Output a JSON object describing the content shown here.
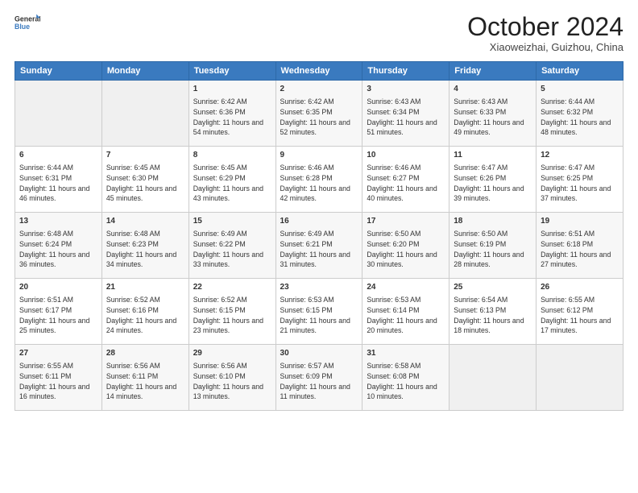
{
  "header": {
    "logo_line1": "General",
    "logo_line2": "Blue",
    "main_title": "October 2024",
    "subtitle": "Xiaoweizhai, Guizhou, China"
  },
  "weekdays": [
    "Sunday",
    "Monday",
    "Tuesday",
    "Wednesday",
    "Thursday",
    "Friday",
    "Saturday"
  ],
  "weeks": [
    [
      {
        "num": "",
        "info": ""
      },
      {
        "num": "",
        "info": ""
      },
      {
        "num": "1",
        "info": "Sunrise: 6:42 AM\nSunset: 6:36 PM\nDaylight: 11 hours and 54 minutes."
      },
      {
        "num": "2",
        "info": "Sunrise: 6:42 AM\nSunset: 6:35 PM\nDaylight: 11 hours and 52 minutes."
      },
      {
        "num": "3",
        "info": "Sunrise: 6:43 AM\nSunset: 6:34 PM\nDaylight: 11 hours and 51 minutes."
      },
      {
        "num": "4",
        "info": "Sunrise: 6:43 AM\nSunset: 6:33 PM\nDaylight: 11 hours and 49 minutes."
      },
      {
        "num": "5",
        "info": "Sunrise: 6:44 AM\nSunset: 6:32 PM\nDaylight: 11 hours and 48 minutes."
      }
    ],
    [
      {
        "num": "6",
        "info": "Sunrise: 6:44 AM\nSunset: 6:31 PM\nDaylight: 11 hours and 46 minutes."
      },
      {
        "num": "7",
        "info": "Sunrise: 6:45 AM\nSunset: 6:30 PM\nDaylight: 11 hours and 45 minutes."
      },
      {
        "num": "8",
        "info": "Sunrise: 6:45 AM\nSunset: 6:29 PM\nDaylight: 11 hours and 43 minutes."
      },
      {
        "num": "9",
        "info": "Sunrise: 6:46 AM\nSunset: 6:28 PM\nDaylight: 11 hours and 42 minutes."
      },
      {
        "num": "10",
        "info": "Sunrise: 6:46 AM\nSunset: 6:27 PM\nDaylight: 11 hours and 40 minutes."
      },
      {
        "num": "11",
        "info": "Sunrise: 6:47 AM\nSunset: 6:26 PM\nDaylight: 11 hours and 39 minutes."
      },
      {
        "num": "12",
        "info": "Sunrise: 6:47 AM\nSunset: 6:25 PM\nDaylight: 11 hours and 37 minutes."
      }
    ],
    [
      {
        "num": "13",
        "info": "Sunrise: 6:48 AM\nSunset: 6:24 PM\nDaylight: 11 hours and 36 minutes."
      },
      {
        "num": "14",
        "info": "Sunrise: 6:48 AM\nSunset: 6:23 PM\nDaylight: 11 hours and 34 minutes."
      },
      {
        "num": "15",
        "info": "Sunrise: 6:49 AM\nSunset: 6:22 PM\nDaylight: 11 hours and 33 minutes."
      },
      {
        "num": "16",
        "info": "Sunrise: 6:49 AM\nSunset: 6:21 PM\nDaylight: 11 hours and 31 minutes."
      },
      {
        "num": "17",
        "info": "Sunrise: 6:50 AM\nSunset: 6:20 PM\nDaylight: 11 hours and 30 minutes."
      },
      {
        "num": "18",
        "info": "Sunrise: 6:50 AM\nSunset: 6:19 PM\nDaylight: 11 hours and 28 minutes."
      },
      {
        "num": "19",
        "info": "Sunrise: 6:51 AM\nSunset: 6:18 PM\nDaylight: 11 hours and 27 minutes."
      }
    ],
    [
      {
        "num": "20",
        "info": "Sunrise: 6:51 AM\nSunset: 6:17 PM\nDaylight: 11 hours and 25 minutes."
      },
      {
        "num": "21",
        "info": "Sunrise: 6:52 AM\nSunset: 6:16 PM\nDaylight: 11 hours and 24 minutes."
      },
      {
        "num": "22",
        "info": "Sunrise: 6:52 AM\nSunset: 6:15 PM\nDaylight: 11 hours and 23 minutes."
      },
      {
        "num": "23",
        "info": "Sunrise: 6:53 AM\nSunset: 6:15 PM\nDaylight: 11 hours and 21 minutes."
      },
      {
        "num": "24",
        "info": "Sunrise: 6:53 AM\nSunset: 6:14 PM\nDaylight: 11 hours and 20 minutes."
      },
      {
        "num": "25",
        "info": "Sunrise: 6:54 AM\nSunset: 6:13 PM\nDaylight: 11 hours and 18 minutes."
      },
      {
        "num": "26",
        "info": "Sunrise: 6:55 AM\nSunset: 6:12 PM\nDaylight: 11 hours and 17 minutes."
      }
    ],
    [
      {
        "num": "27",
        "info": "Sunrise: 6:55 AM\nSunset: 6:11 PM\nDaylight: 11 hours and 16 minutes."
      },
      {
        "num": "28",
        "info": "Sunrise: 6:56 AM\nSunset: 6:11 PM\nDaylight: 11 hours and 14 minutes."
      },
      {
        "num": "29",
        "info": "Sunrise: 6:56 AM\nSunset: 6:10 PM\nDaylight: 11 hours and 13 minutes."
      },
      {
        "num": "30",
        "info": "Sunrise: 6:57 AM\nSunset: 6:09 PM\nDaylight: 11 hours and 11 minutes."
      },
      {
        "num": "31",
        "info": "Sunrise: 6:58 AM\nSunset: 6:08 PM\nDaylight: 11 hours and 10 minutes."
      },
      {
        "num": "",
        "info": ""
      },
      {
        "num": "",
        "info": ""
      }
    ]
  ]
}
